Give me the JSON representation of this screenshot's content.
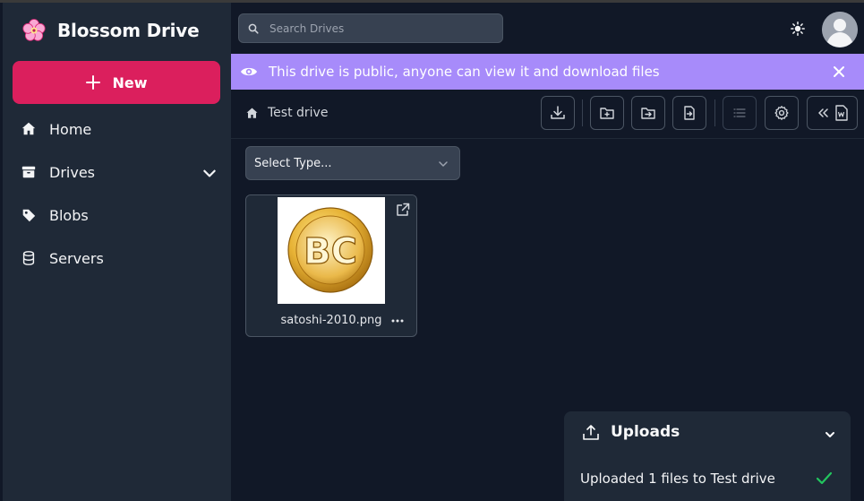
{
  "app": {
    "title": "Blossom Drive"
  },
  "sidebar": {
    "new_label": "New",
    "items": [
      {
        "label": "Home",
        "icon": "home-icon"
      },
      {
        "label": "Drives",
        "icon": "archive-icon"
      },
      {
        "label": "Blobs",
        "icon": "tag-icon"
      },
      {
        "label": "Servers",
        "icon": "database-icon"
      }
    ]
  },
  "header": {
    "search_placeholder": "Search Drives"
  },
  "banner": {
    "text": "This drive is public, anyone can view it and download files"
  },
  "breadcrumb": {
    "label": "Test drive"
  },
  "filter": {
    "selected": "Select Type..."
  },
  "files": [
    {
      "name": "satoshi-2010.png",
      "thumb_text": "BC"
    }
  ],
  "uploads": {
    "title": "Uploads",
    "message": "Uploaded 1 files to Test drive"
  },
  "colors": {
    "accent": "#db1f5d",
    "banner": "#a78bfa",
    "sidebar_bg": "#1f2937",
    "main_bg": "#111827",
    "success": "#22c55e"
  }
}
